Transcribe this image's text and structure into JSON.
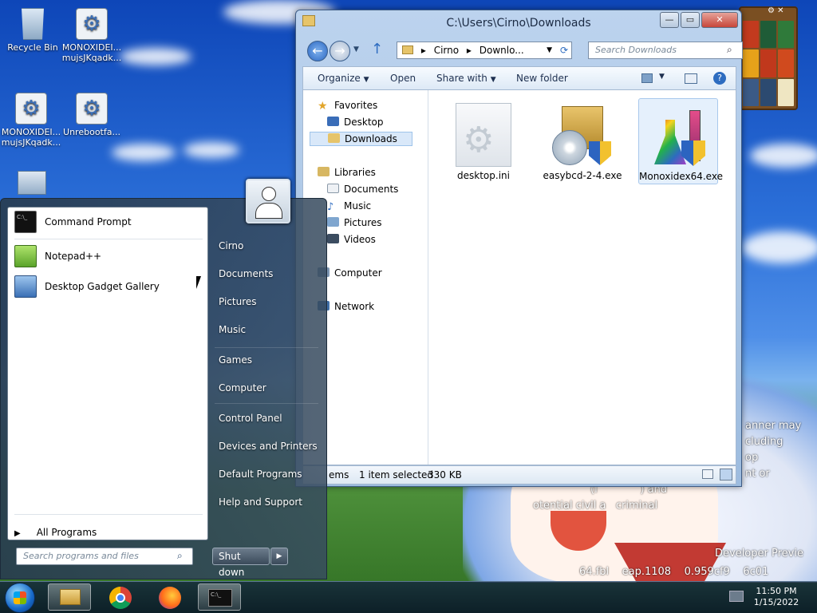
{
  "desktop": {
    "icons": [
      {
        "label": "Recycle Bin",
        "icon": "recycle-bin-icon"
      },
      {
        "label": "MONOXIDEI... mujsJKqadk...",
        "icon": "file-icon"
      },
      {
        "label": "MONOXIDEI... mujsJKqadk...",
        "icon": "settings-file-icon"
      },
      {
        "label": "Unrebootfa...",
        "icon": "settings-file-icon"
      }
    ],
    "wallpaper_text": [
      "anner may",
      "cluding",
      "op",
      "nt or",
      "(i             ) and",
      "otential civil a   criminal",
      "Developer Previe",
      "64.fbl    eap.1108    0.959cf9    6c01"
    ]
  },
  "explorer": {
    "title": "C:\\Users\\Cirno\\Downloads",
    "address": [
      "Cirno",
      "Downlo..."
    ],
    "search_placeholder": "Search Downloads",
    "toolbar": {
      "organize": "Organize",
      "open": "Open",
      "share_with": "Share with",
      "new_folder": "New folder"
    },
    "nav": {
      "favorites": "Favorites",
      "desktop": "Desktop",
      "downloads": "Downloads",
      "libraries": "Libraries",
      "documents": "Documents",
      "music": "Music",
      "pictures": "Pictures",
      "videos": "Videos",
      "computer": "Computer",
      "network": "Network"
    },
    "files": [
      {
        "name": "desktop.ini"
      },
      {
        "name": "easybcd-2-4.exe"
      },
      {
        "name": "Monoxidex64.exe"
      }
    ],
    "status": {
      "items": "ems",
      "selected": "1 item selected",
      "size": "330 KB"
    }
  },
  "start_menu": {
    "programs": [
      "Command Prompt",
      "Notepad++",
      "Desktop Gadget Gallery"
    ],
    "all_programs": "All Programs",
    "search_placeholder": "Search programs and files",
    "right": {
      "user": "Cirno",
      "documents": "Documents",
      "pictures": "Pictures",
      "music": "Music",
      "games": "Games",
      "computer": "Computer",
      "control_panel": "Control Panel",
      "devices_printers": "Devices and Printers",
      "default_programs": "Default Programs",
      "help_support": "Help and Support"
    },
    "shutdown": "Shut down"
  },
  "taskbar": {
    "time": "11:50 PM",
    "date": "1/15/2022"
  }
}
